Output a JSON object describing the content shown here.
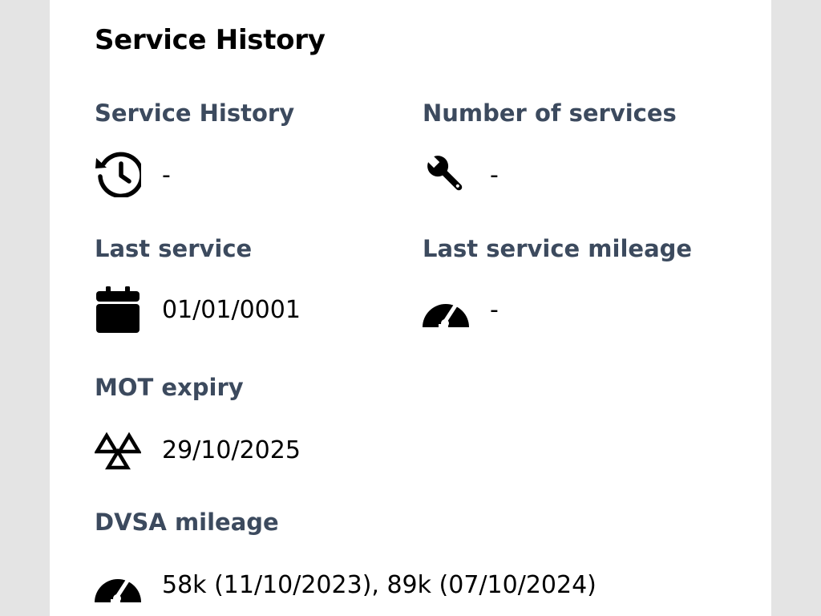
{
  "section": {
    "title": "Service History"
  },
  "fields": {
    "service_history": {
      "label": "Service History",
      "value": "-",
      "icon": "history-icon"
    },
    "number_of_services": {
      "label": "Number of services",
      "value": "-",
      "icon": "wrench-icon"
    },
    "last_service": {
      "label": "Last service",
      "value": "01/01/0001",
      "icon": "calendar-icon"
    },
    "last_service_mileage": {
      "label": "Last service mileage",
      "value": "-",
      "icon": "speedometer-icon"
    },
    "mot_expiry": {
      "label": "MOT expiry",
      "value": "29/10/2025",
      "icon": "mot-triangles-icon"
    },
    "dvsa_mileage": {
      "label": "DVSA mileage",
      "value": "58k (11/10/2023), 89k (07/10/2024)",
      "icon": "speedometer-icon"
    }
  },
  "colors": {
    "label": "#3c4a5e",
    "value": "#000000",
    "card": "#ffffff",
    "backdrop": "#e4e4e4"
  }
}
